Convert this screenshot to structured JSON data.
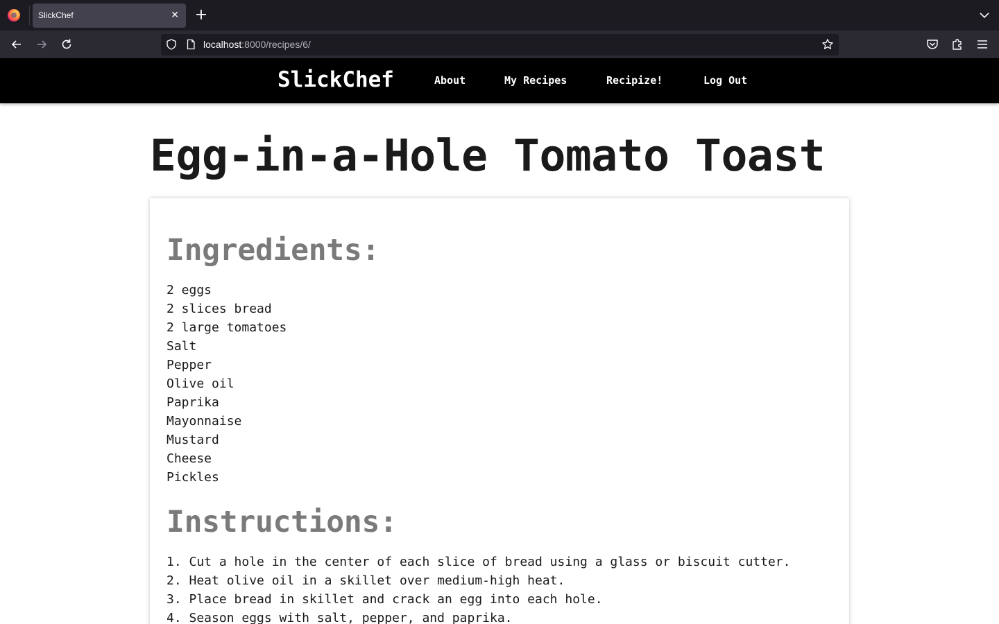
{
  "browser": {
    "tab_title": "SlickChef",
    "url_host": "localhost",
    "url_rest": ":8000/recipes/6/"
  },
  "site": {
    "brand": "SlickChef",
    "nav": [
      {
        "label": "About"
      },
      {
        "label": "My Recipes"
      },
      {
        "label": "Recipize!"
      },
      {
        "label": "Log Out"
      }
    ]
  },
  "recipe": {
    "title": "Egg-in-a-Hole Tomato Toast",
    "ingredients_heading": "Ingredients:",
    "ingredients": [
      "2 eggs",
      "2 slices bread",
      "2 large tomatoes",
      "Salt",
      "Pepper",
      "Olive oil",
      "Paprika",
      "Mayonnaise",
      "Mustard",
      "Cheese",
      "Pickles"
    ],
    "instructions_heading": "Instructions:",
    "instructions": [
      "1. Cut a hole in the center of each slice of bread using a glass or biscuit cutter.",
      "2. Heat olive oil in a skillet over medium-high heat.",
      "3. Place bread in skillet and crack an egg into each hole.",
      "4. Season eggs with salt, pepper, and paprika."
    ]
  },
  "icons": {
    "browser_logo": "firefox-icon",
    "back": "back-arrow-icon",
    "forward": "forward-arrow-icon",
    "reload": "reload-icon",
    "shield": "tracking-protection-shield-icon",
    "page": "page-info-icon",
    "bookmark": "star-icon",
    "pocket": "pocket-icon",
    "extensions": "extensions-icon",
    "menu": "hamburger-menu-icon"
  }
}
